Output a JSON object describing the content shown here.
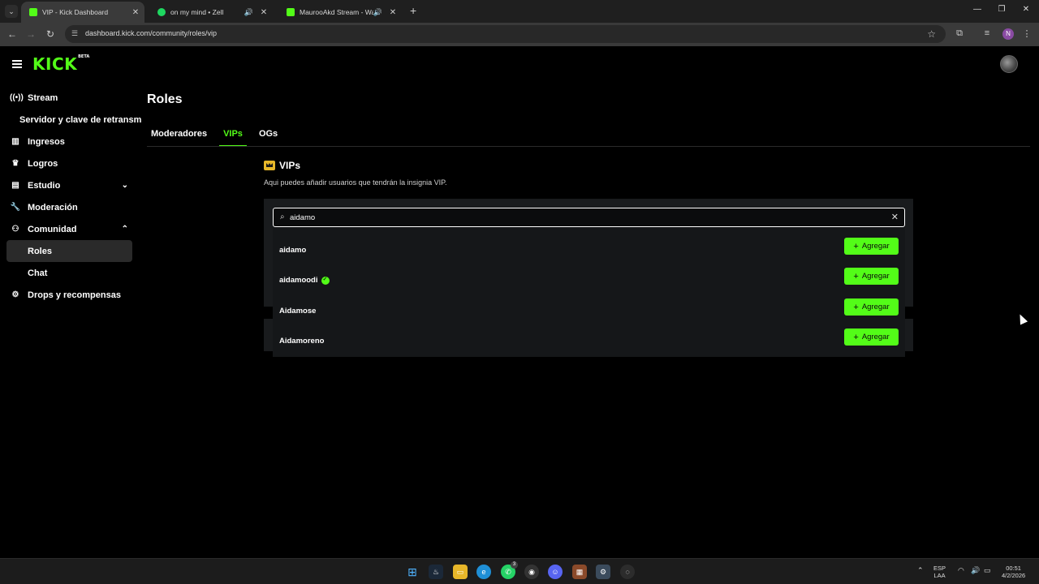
{
  "browser": {
    "tabs": [
      {
        "title": "VIP - Kick Dashboard",
        "favicon_color": "#53fc18",
        "active": true,
        "audio": false
      },
      {
        "title": "on my mind • Zell",
        "favicon_color": "#1ed760",
        "active": false,
        "audio": true
      },
      {
        "title": "MaurooAkd Stream - Watch",
        "favicon_color": "#53fc18",
        "active": false,
        "audio": true
      }
    ],
    "new_tab": "+",
    "url": "dashboard.kick.com/community/roles/vip",
    "profile_initial": "N"
  },
  "header": {
    "logo": "KICK",
    "logo_badge": "BETA"
  },
  "sidebar": {
    "items": [
      {
        "label": "Stream",
        "icon": "broadcast-icon"
      },
      {
        "label": "Servidor y clave de retransm"
      },
      {
        "label": "Ingresos",
        "icon": "chart-icon"
      },
      {
        "label": "Logros",
        "icon": "trophy-icon"
      },
      {
        "label": "Estudio",
        "icon": "studio-icon"
      },
      {
        "label": "Moderación",
        "icon": "wrench-icon"
      },
      {
        "label": "Comunidad",
        "icon": "people-icon"
      },
      {
        "label": "Roles"
      },
      {
        "label": "Chat"
      },
      {
        "label": "Drops y recompensas",
        "icon": "gift-icon"
      }
    ]
  },
  "main": {
    "title": "Roles",
    "tabs": [
      {
        "label": "Moderadores"
      },
      {
        "label": "VIPs"
      },
      {
        "label": "OGs"
      }
    ],
    "vip": {
      "title": "VIPs",
      "description": "Aqui puedes añadir usuarios que tendrán la insignia VIP."
    },
    "search": {
      "value": "aidamo",
      "placeholder": ""
    },
    "results": [
      {
        "name": "aidamo",
        "verified": false
      },
      {
        "name": "aidamoodi",
        "verified": true
      },
      {
        "name": "Aidamose",
        "verified": false
      },
      {
        "name": "Aidamoreno",
        "verified": false
      }
    ],
    "add_label": "Agregar"
  },
  "taskbar": {
    "language": "ESP",
    "layout": "LAA",
    "time": "00:51",
    "date": "4/2/2026",
    "whatsapp_badge": "3"
  },
  "colors": {
    "accent": "#53fc18",
    "background": "#000000",
    "panel": "#191b1d"
  }
}
